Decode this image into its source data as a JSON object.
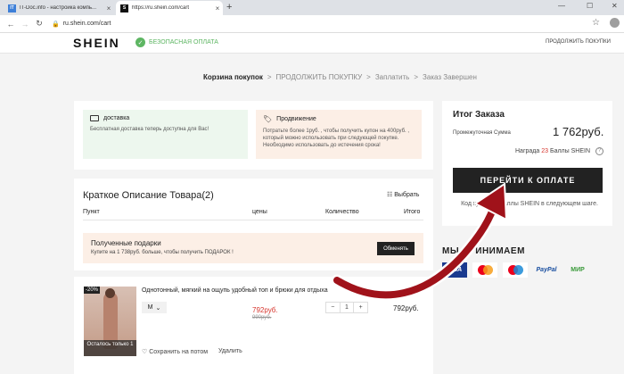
{
  "browser": {
    "tabs": [
      {
        "favicon": "IT",
        "title": "IT-Doc.info - настройка компь..."
      },
      {
        "favicon": "S",
        "title": "https://ru.shein.com/cart"
      }
    ],
    "url": "ru.shein.com/cart"
  },
  "header": {
    "logo": "SHEIN",
    "secure": "БЕЗОПАСНАЯ ОПЛАТА",
    "continue": "ПРОДОЛЖИТЬ ПОКУПКИ"
  },
  "breadcrumb": [
    "Корзина покупок",
    "ПРОДОЛЖИТЬ ПОКУПКУ",
    "Заплатить",
    "Заказ Завершен"
  ],
  "promo": {
    "delivery_title": "доставка",
    "delivery_text": "Бесплатная доставка теперь доступна для Вас!",
    "promo_title": "Продвижение",
    "promo_text": "Потратьте более 1руб. , чтобы получить купон на 400руб. , который можно использовать при следующей покупке. Необходимо использовать до истечения срока!"
  },
  "summary": {
    "title": "Краткое Описание Товара(2)",
    "choose": "Выбрать",
    "columns": [
      "Пункт",
      "цены",
      "Количество",
      "Итого"
    ]
  },
  "gift": {
    "title": "Полученные подарки",
    "text": "Купите на 1 738руб. больше, чтобы получить ПОДАРОК !",
    "button": "Обменять"
  },
  "product": {
    "discount": "-20%",
    "left_note": "Осталось только 1",
    "name": "Однотонный, мягкий на ощупь удобный топ и брюки для отдыха",
    "size": "M",
    "price": "792руб.",
    "old_price": "990руб.",
    "qty": "1",
    "total": "792руб.",
    "save_later": "Сохранить на потом",
    "delete": "Удалить"
  },
  "order": {
    "title": "Итог Заказа",
    "subtotal_label": "Промежуточная Сумма",
    "subtotal": "1 762руб.",
    "reward_prefix": "Награда",
    "reward_num": "23",
    "reward_suffix": "Баллы SHEIN",
    "checkout": "ПЕРЕЙТИ К ОПЛАТЕ",
    "coupon_note": "Код купона и баллы SHEIN в следующем шаге."
  },
  "payments": {
    "title": "МЫ ПРИНИМАЕМ",
    "cards": [
      "VISA",
      "PayPal",
      "МИР"
    ]
  },
  "colors": {
    "accent": "#d6342c",
    "secure": "#5eb663",
    "arrow": "#a0121a"
  }
}
